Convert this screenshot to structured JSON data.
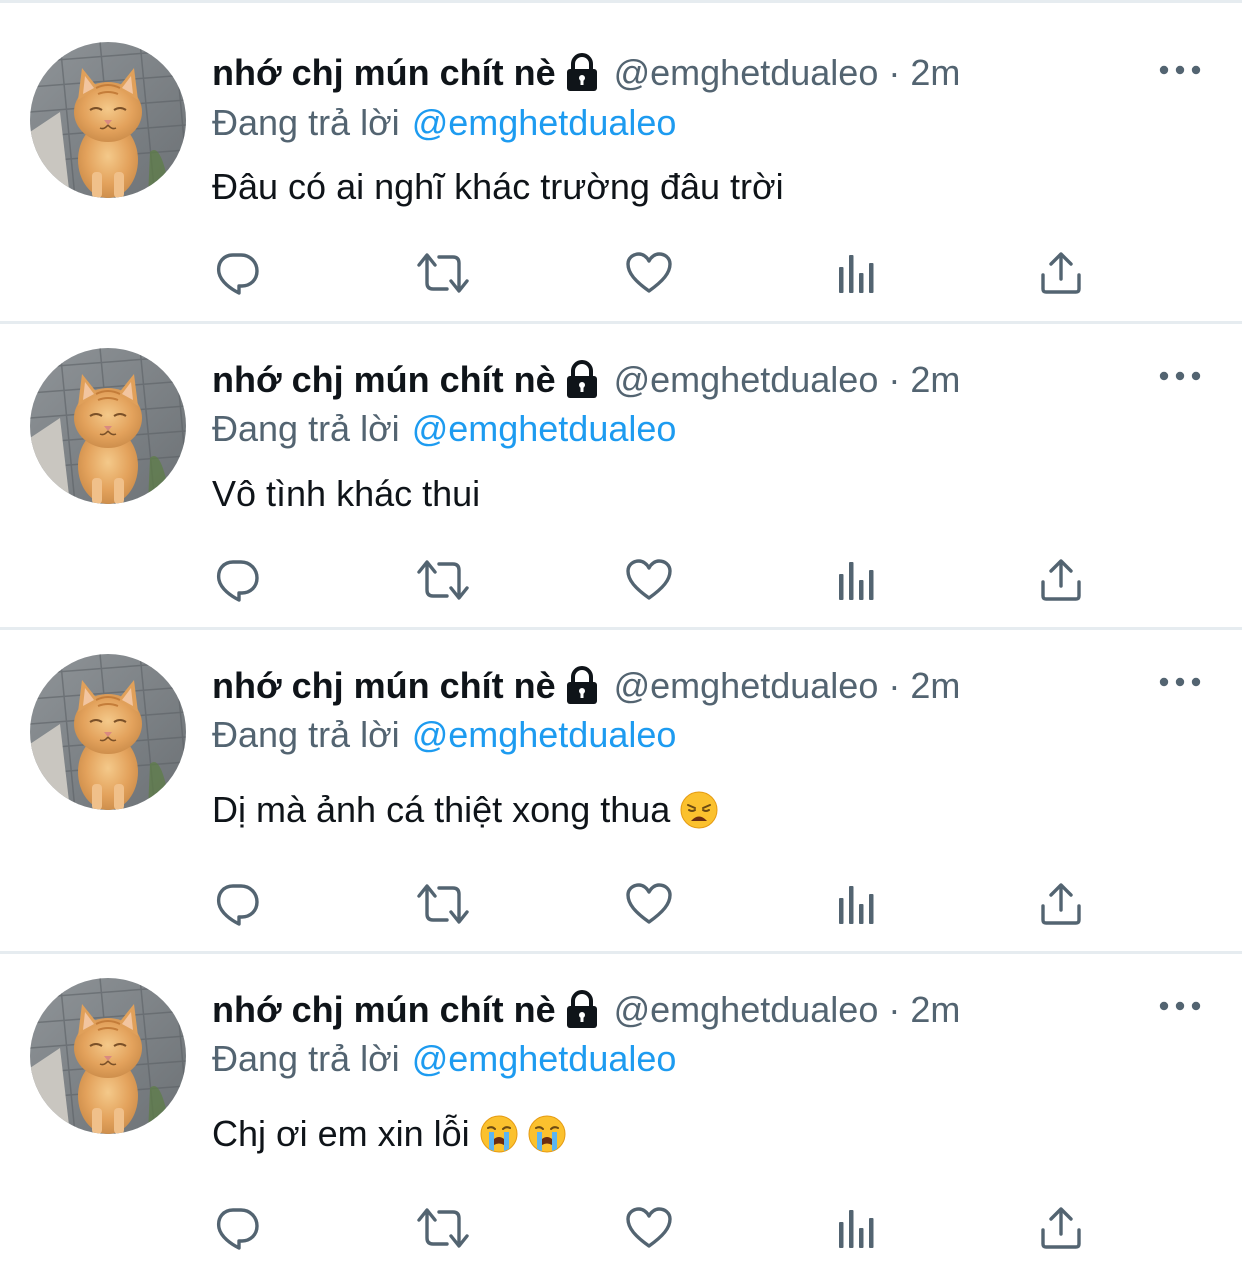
{
  "colors": {
    "text": "#0f1419",
    "secondary": "#536471",
    "accent": "#1d9bf0",
    "divider": "#e6ecf0"
  },
  "icons": {
    "lock": "lock-icon",
    "more": "more-icon",
    "reply": "reply-icon",
    "retweet": "retweet-icon",
    "like": "heart-icon",
    "analytics": "analytics-icon",
    "share": "share-icon"
  },
  "tweets": [
    {
      "name": "nhớ chj mún chít nè",
      "handle": "@emghetdualeo",
      "separator": "·",
      "time": "2m",
      "reply_label": "Đang trả lời",
      "reply_handle": "@emghetdualeo",
      "text": "Đâu có ai nghĩ khác trường đâu trời",
      "emojis": []
    },
    {
      "name": "nhớ chj mún chít nè",
      "handle": "@emghetdualeo",
      "separator": "·",
      "time": "2m",
      "reply_label": "Đang trả lời",
      "reply_handle": "@emghetdualeo",
      "text": "Vô tình khác thui",
      "emojis": []
    },
    {
      "name": "nhớ chj mún chít nè",
      "handle": "@emghetdualeo",
      "separator": "·",
      "time": "2m",
      "reply_label": "Đang trả lời",
      "reply_handle": "@emghetdualeo",
      "text": "Dị mà ảnh cá thiệt xong thua",
      "emojis": [
        "weary-face"
      ]
    },
    {
      "name": "nhớ chj mún chít nè",
      "handle": "@emghetdualeo",
      "separator": "·",
      "time": "2m",
      "reply_label": "Đang trả lời",
      "reply_handle": "@emghetdualeo",
      "text": "Chj ơi em xin lỗi",
      "emojis": [
        "loudly-crying-face",
        "loudly-crying-face"
      ]
    }
  ]
}
